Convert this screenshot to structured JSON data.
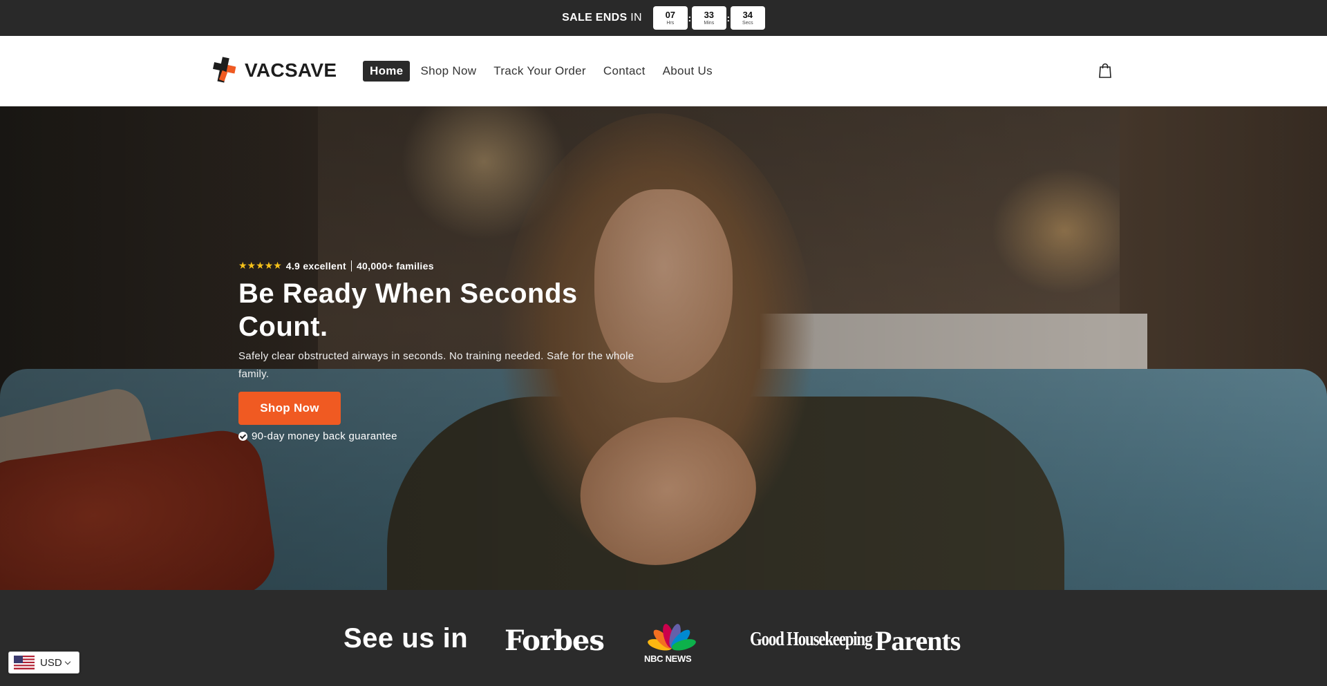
{
  "announcement": {
    "label_bold": "SALE ENDS",
    "label_rest": "IN",
    "timer": [
      {
        "value": "07",
        "unit": "Hrs"
      },
      {
        "value": "33",
        "unit": "Mins"
      },
      {
        "value": "34",
        "unit": "Secs"
      }
    ],
    "separator": ":"
  },
  "header": {
    "logo_text": "VACSAVE",
    "brand_colors": {
      "accent": "#f05a22",
      "dark": "#1d1d1d"
    },
    "nav": [
      {
        "label": "Home",
        "active": true
      },
      {
        "label": "Shop Now",
        "active": false
      },
      {
        "label": "Track Your Order",
        "active": false
      },
      {
        "label": "Contact",
        "active": false
      },
      {
        "label": "About Us",
        "active": false
      }
    ],
    "cart_icon": "shopping-bag-icon"
  },
  "hero": {
    "stars": "★★★★★",
    "rating_text": "4.9 excellent",
    "families_text": "40,000+ families",
    "headline": "Be Ready When Seconds Count.",
    "subtext": "Safely clear obstructed airways in seconds. No training needed. Safe for the whole family.",
    "cta_label": "Shop Now",
    "guarantee": "90-day money back guarantee",
    "cta_color": "#f05a22"
  },
  "press": {
    "title": "See us in",
    "logos": [
      "Forbes",
      "NBC NEWS",
      "Good Housekeeping",
      "Parents"
    ]
  },
  "currency": {
    "code": "USD",
    "flag_icon": "us-flag-icon"
  }
}
